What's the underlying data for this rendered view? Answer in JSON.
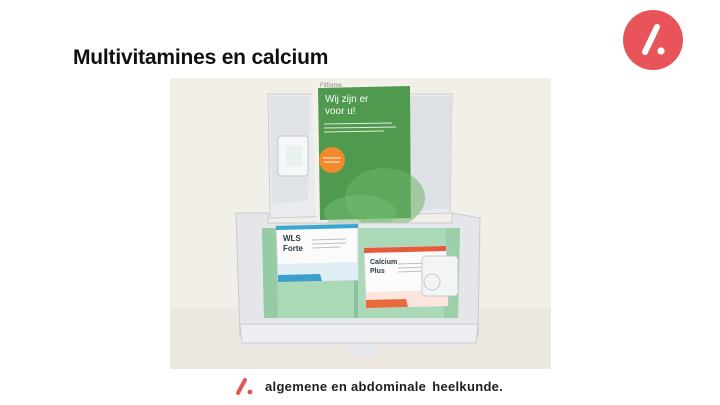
{
  "slide": {
    "title": "Multivitamines en calcium"
  },
  "photo": {
    "booklet_brand": "Fitforme",
    "booklet_heading_line1": "Wij zijn er",
    "booklet_heading_line2": "voor u!",
    "box1_name_line1": "WLS",
    "box1_name_line2": "Forte",
    "box2_name_line1": "Calcium",
    "box2_name_line2": "Plus"
  },
  "footer": {
    "brand_part1": "algemene en abdominale",
    "brand_part2": "heelkunde."
  },
  "colors": {
    "brand_red": "#e8545a",
    "booklet_green": "#4f9a4f",
    "tray_green": "#a9d9b6",
    "badge_orange": "#f08a2c"
  }
}
